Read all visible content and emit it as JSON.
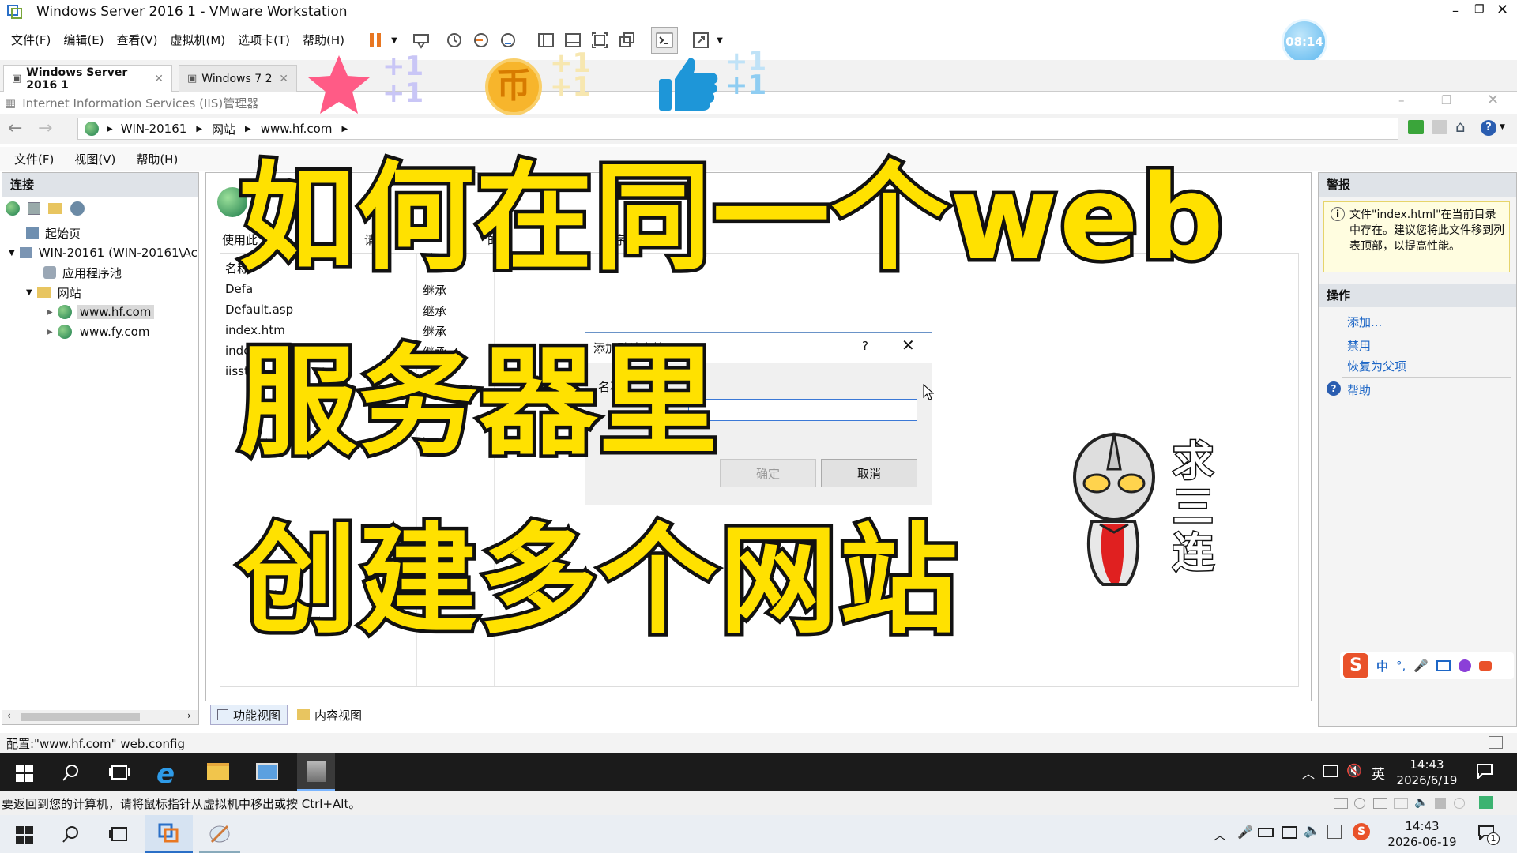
{
  "window": {
    "title": "Windows Server 2016 1 - VMware Workstation"
  },
  "vm_menu": [
    "文件(F)",
    "编辑(E)",
    "查看(V)",
    "虚拟机(M)",
    "选项卡(T)",
    "帮助(H)"
  ],
  "vm_tabs": [
    {
      "label": "Windows Server 2016 1",
      "active": true
    },
    {
      "label": "Windows 7 2",
      "active": false
    }
  ],
  "timer_badge": "08:14",
  "iis": {
    "title": "Internet Information Services (IIS)管理器",
    "breadcrumb": [
      "WIN-20161",
      "网站",
      "www.hf.com"
    ],
    "menu": [
      "文件(F)",
      "视图(V)",
      "帮助(H)"
    ],
    "connections_title": "连接",
    "tree": [
      {
        "label": "起始页"
      },
      {
        "label": "WIN-20161 (WIN-20161\\Ac"
      },
      {
        "label": "应用程序池"
      },
      {
        "label": "网站"
      },
      {
        "label": "www.hf.com",
        "selected": true
      },
      {
        "label": "www.fy.com"
      }
    ],
    "main_desc_fragments": [
      "使用此",
      "请求",
      "的默",
      "序"
    ],
    "list_header_name": "名称",
    "list_rows": [
      {
        "name": "Defa",
        "entry": "继承"
      },
      {
        "name": "Default.asp",
        "entry": "继承"
      },
      {
        "name": "index.htm",
        "entry": "继承"
      },
      {
        "name": "index.html",
        "entry": "继承"
      },
      {
        "name": "iisst",
        "entry": ""
      }
    ],
    "alerts_title": "警报",
    "alert_text": "文件\"index.html\"在当前目录中存在。建议您将此文件移到列表顶部，以提高性能。",
    "actions_title": "操作",
    "actions": [
      "添加...",
      "禁用",
      "恢复为父项",
      "帮助"
    ],
    "view_tabs": [
      "功能视图",
      "内容视图"
    ],
    "status": "配置:\"www.hf.com\" web.config"
  },
  "dialog": {
    "title": "添加默认文档",
    "help": "?",
    "name_label": "名称",
    "ok": "确定",
    "cancel": "取消"
  },
  "guest_taskbar": {
    "ime": "英",
    "time": "14:43",
    "date": "2026/6/19"
  },
  "vm_status": "要返回到您的计算机，请将鼠标指针从虚拟机中移出或按 Ctrl+Alt。",
  "host_taskbar": {
    "time": "14:43",
    "date": "2026-06-19",
    "notif_count": "1"
  },
  "overlay": {
    "title_lines": [
      "如何在同一个web",
      "服务器里",
      "创建多个网站"
    ],
    "plus_one": "+1",
    "coin_char": "币",
    "sticker_text": "求三连"
  },
  "ime_bar": [
    "中",
    "°,"
  ],
  "colors": {
    "accent": "#1d66c6",
    "title_yellow": "#ffe100",
    "star": "#ff5b86",
    "coin": "#f7b52c",
    "thumb": "#1e96d8"
  }
}
